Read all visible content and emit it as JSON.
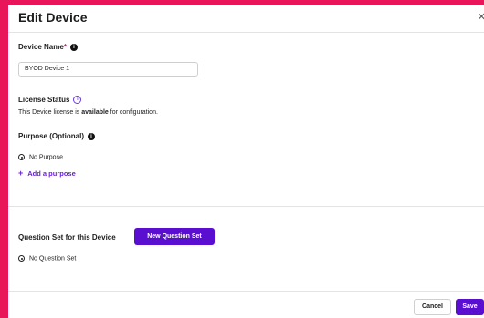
{
  "dialog": {
    "title": "Edit Device",
    "close_icon": "close-icon"
  },
  "device_name": {
    "label": "Device Name",
    "required_mark": "*",
    "value": "BYOD Device 1",
    "info_icon": "info-icon"
  },
  "license_status": {
    "label": "License Status",
    "text_prefix": "This Device license is ",
    "text_status": "available",
    "text_suffix": " for configuration.",
    "info_icon": "info-outline-icon"
  },
  "purpose": {
    "label": "Purpose (Optional)",
    "selected_option": "No Purpose",
    "add_link": "Add a purpose",
    "add_icon": "plus-icon"
  },
  "question_set": {
    "label": "Question Set for this Device",
    "new_button": "New Question Set",
    "selected_option": "No Question Set"
  },
  "footer": {
    "cancel": "Cancel",
    "save": "Save"
  },
  "colors": {
    "background": "#e8155a",
    "accent": "#5a0fd0",
    "link": "#6a1fd6"
  }
}
